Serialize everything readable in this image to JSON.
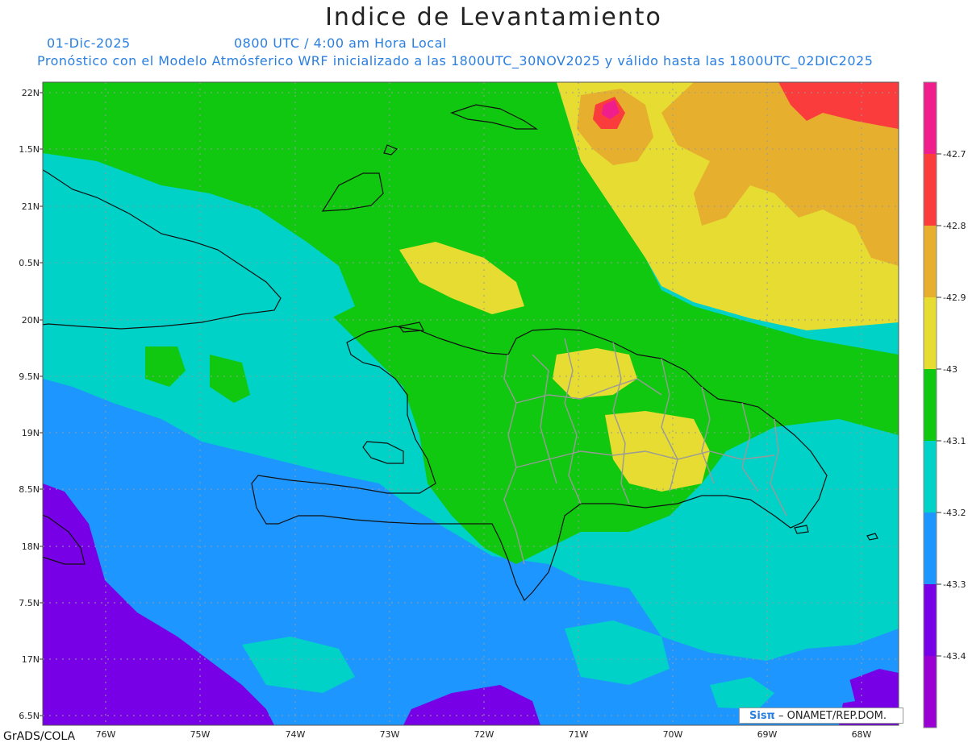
{
  "header": {
    "title": "Indice de Levantamiento",
    "date": "01-Dic-2025",
    "time": "0800 UTC / 4:00 am Hora Local",
    "description": "Pronóstico con el Modelo Atmósferico WRF inicializado a las 1800UTC_30NOV2025 y válido hasta las  1800UTC_02DIC2025"
  },
  "axes": {
    "lat_labels": [
      "22N",
      "1.5N",
      "21N",
      "0.5N",
      "20N",
      "9.5N",
      "19N",
      "8.5N",
      "18N",
      "7.5N",
      "17N",
      "6.5N"
    ],
    "lon_labels": [
      "76W",
      "75W",
      "74W",
      "73W",
      "72W",
      "71W",
      "70W",
      "69W",
      "68W"
    ]
  },
  "colorbar": {
    "labels": [
      "-42.7",
      "-42.8",
      "-42.9",
      "-43",
      "-43.1",
      "-43.2",
      "-43.3",
      "-43.4"
    ],
    "colors": [
      "#f01e8c",
      "#fa3c3c",
      "#e6af2d",
      "#e6dc32",
      "#11c811",
      "#00d2c8",
      "#1e96ff",
      "#7800e6",
      "#9a00d2"
    ]
  },
  "legend": {
    "fill_colors": {
      "purple": "#7800e6",
      "blue": "#1e96ff",
      "cyan": "#00d2c8",
      "green": "#11c811",
      "yellow": "#e6dc32",
      "orange": "#e6af2d",
      "red": "#fa3c3c",
      "magenta": "#f01e8c"
    }
  },
  "footer": {
    "credit": "GrADS/COLA",
    "logo_brand": "Sisπ",
    "logo_org": " – ONAMET/REP.DOM."
  }
}
